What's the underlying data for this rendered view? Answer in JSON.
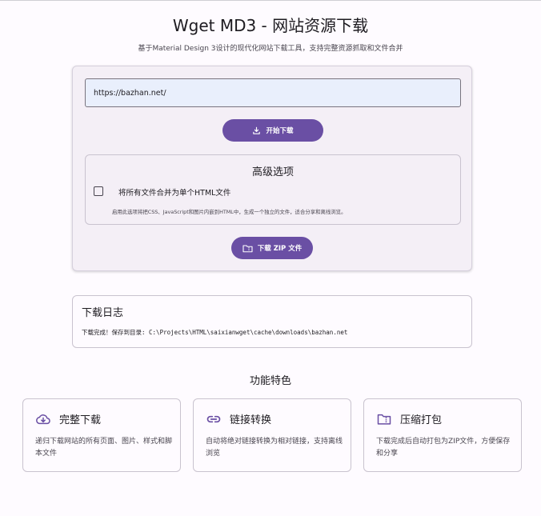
{
  "header": {
    "title": "Wget MD3 - 网站资源下载",
    "subtitle": "基于Material Design 3设计的现代化网站下载工具，支持完整资源抓取和文件合并"
  },
  "form": {
    "url_value": "https://bazhan.net/",
    "start_button": "开始下载",
    "zip_button": "下载 ZIP 文件"
  },
  "advanced": {
    "title": "高级选项",
    "merge_label": "将所有文件合并为单个HTML文件",
    "merge_checked": false,
    "merge_desc": "启用此选项将把CSS、JavaScript和图片内嵌到HTML中，生成一个独立的文件，适合分享和离线浏览。"
  },
  "log": {
    "title": "下载日志",
    "text": "下载完成！保存到目录: C:\\Projects\\HTML\\saixianwget\\cache\\downloads\\bazhan.net"
  },
  "features": {
    "title": "功能特色",
    "items": [
      {
        "icon": "cloud-download-icon",
        "title": "完整下载",
        "desc": "递归下载网站的所有页面、图片、样式和脚本文件"
      },
      {
        "icon": "link-icon",
        "title": "链接转换",
        "desc": "自动将绝对链接转换为相对链接，支持离线浏览"
      },
      {
        "icon": "folder-zip-icon",
        "title": "压缩打包",
        "desc": "下载完成后自动打包为ZIP文件，方便保存和分享"
      }
    ]
  },
  "colors": {
    "primary": "#6a4fa4",
    "surface": "#f4eff6",
    "background": "#fefbff",
    "input_bg": "#e9effc"
  }
}
